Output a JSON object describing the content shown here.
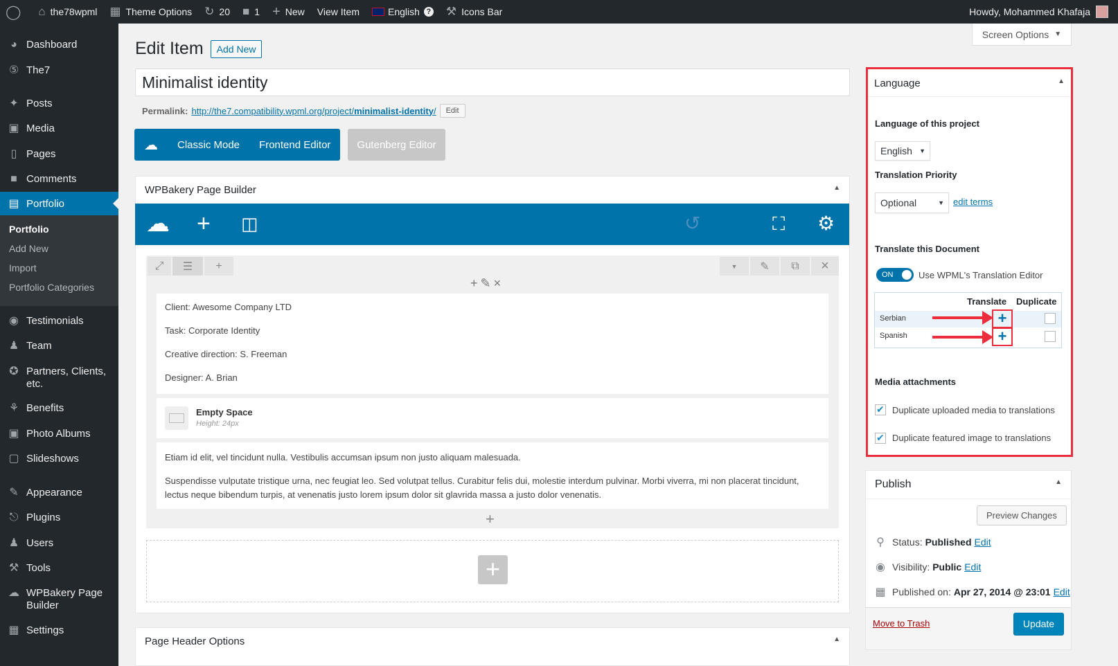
{
  "adminbar": {
    "site": "the78wpml",
    "theme_options": "Theme Options",
    "updates": "20",
    "comments": "1",
    "new": "New",
    "view_item": "View Item",
    "language": "English",
    "icons_bar": "Icons Bar",
    "howdy": "Howdy, Mohammed Khafaja"
  },
  "sidebar": {
    "dashboard": "Dashboard",
    "the7": "The7",
    "posts": "Posts",
    "media": "Media",
    "pages": "Pages",
    "comments": "Comments",
    "portfolio": "Portfolio",
    "sub_portfolio": "Portfolio",
    "sub_add_new": "Add New",
    "sub_import": "Import",
    "sub_categories": "Portfolio Categories",
    "testimonials": "Testimonials",
    "team": "Team",
    "partners": "Partners, Clients, etc.",
    "benefits": "Benefits",
    "photo_albums": "Photo Albums",
    "slideshows": "Slideshows",
    "appearance": "Appearance",
    "plugins": "Plugins",
    "users": "Users",
    "tools": "Tools",
    "wpbakery": "WPBakery Page Builder",
    "settings": "Settings"
  },
  "header": {
    "title": "Edit Item",
    "add_new": "Add New",
    "screen_options": "Screen Options"
  },
  "post": {
    "title": "Minimalist identity",
    "permalink_label": "Permalink:",
    "permalink_base": "http://the7.compatibility.wpml.org/project/",
    "permalink_slug": "minimalist-identity",
    "permalink_end": "/",
    "edit": "Edit"
  },
  "modes": {
    "classic": "Classic Mode",
    "frontend": "Frontend Editor",
    "gutenberg": "Gutenberg Editor"
  },
  "wpb": {
    "title": "WPBakery Page Builder",
    "text1": [
      "Client: Awesome Company LTD",
      "Task: Corporate Identity",
      "Creative direction: S. Freeman",
      "Designer: A. Brian"
    ],
    "empty_space": "Empty Space",
    "empty_height": "Height: 24px",
    "text2a": "Etiam id elit, vel tincidunt nulla. Vestibulis accumsan ipsum non justo aliquam malesuada.",
    "text2b": "Suspendisse vulputate tristique urna, nec feugiat leo. Sed volutpat tellus. Curabitur felis dui, molestie interdum pulvinar. Morbi viverra, mi non placerat tincidunt, lectus neque bibendum turpis, at venenatis justo lorem ipsum dolor sit glavrida massa a justo dolor venenatis."
  },
  "page_header": "Page Header Options",
  "language": {
    "title": "Language",
    "lang_label": "Language of this project",
    "lang_value": "English",
    "priority_label": "Translation Priority",
    "priority_value": "Optional",
    "edit_terms": "edit terms",
    "translate_doc": "Translate this Document",
    "toggle": "ON",
    "use_editor": "Use WPML's Translation Editor",
    "col_translate": "Translate",
    "col_duplicate": "Duplicate",
    "langs": [
      "Serbian",
      "Spanish"
    ],
    "media_label": "Media attachments",
    "dup_media": "Duplicate uploaded media to translations",
    "dup_featured": "Duplicate featured image to translations"
  },
  "publish": {
    "title": "Publish",
    "preview": "Preview Changes",
    "status_label": "Status:",
    "status": "Published",
    "visibility_label": "Visibility:",
    "visibility": "Public",
    "published_label": "Published on:",
    "published": "Apr 27, 2014 @ 23:01",
    "edit": "Edit",
    "trash": "Move to Trash",
    "update": "Update"
  },
  "colors": {
    "primary": "#0073aa",
    "highlight": "#ec2d3c",
    "sidebar": "#23282d"
  },
  "icons": [
    "wordpress-icon",
    "home-icon",
    "theme-options-icon",
    "updates-icon",
    "comment-icon",
    "plus-icon",
    "flag-uk-icon",
    "help-icon",
    "hammer-icon"
  ]
}
